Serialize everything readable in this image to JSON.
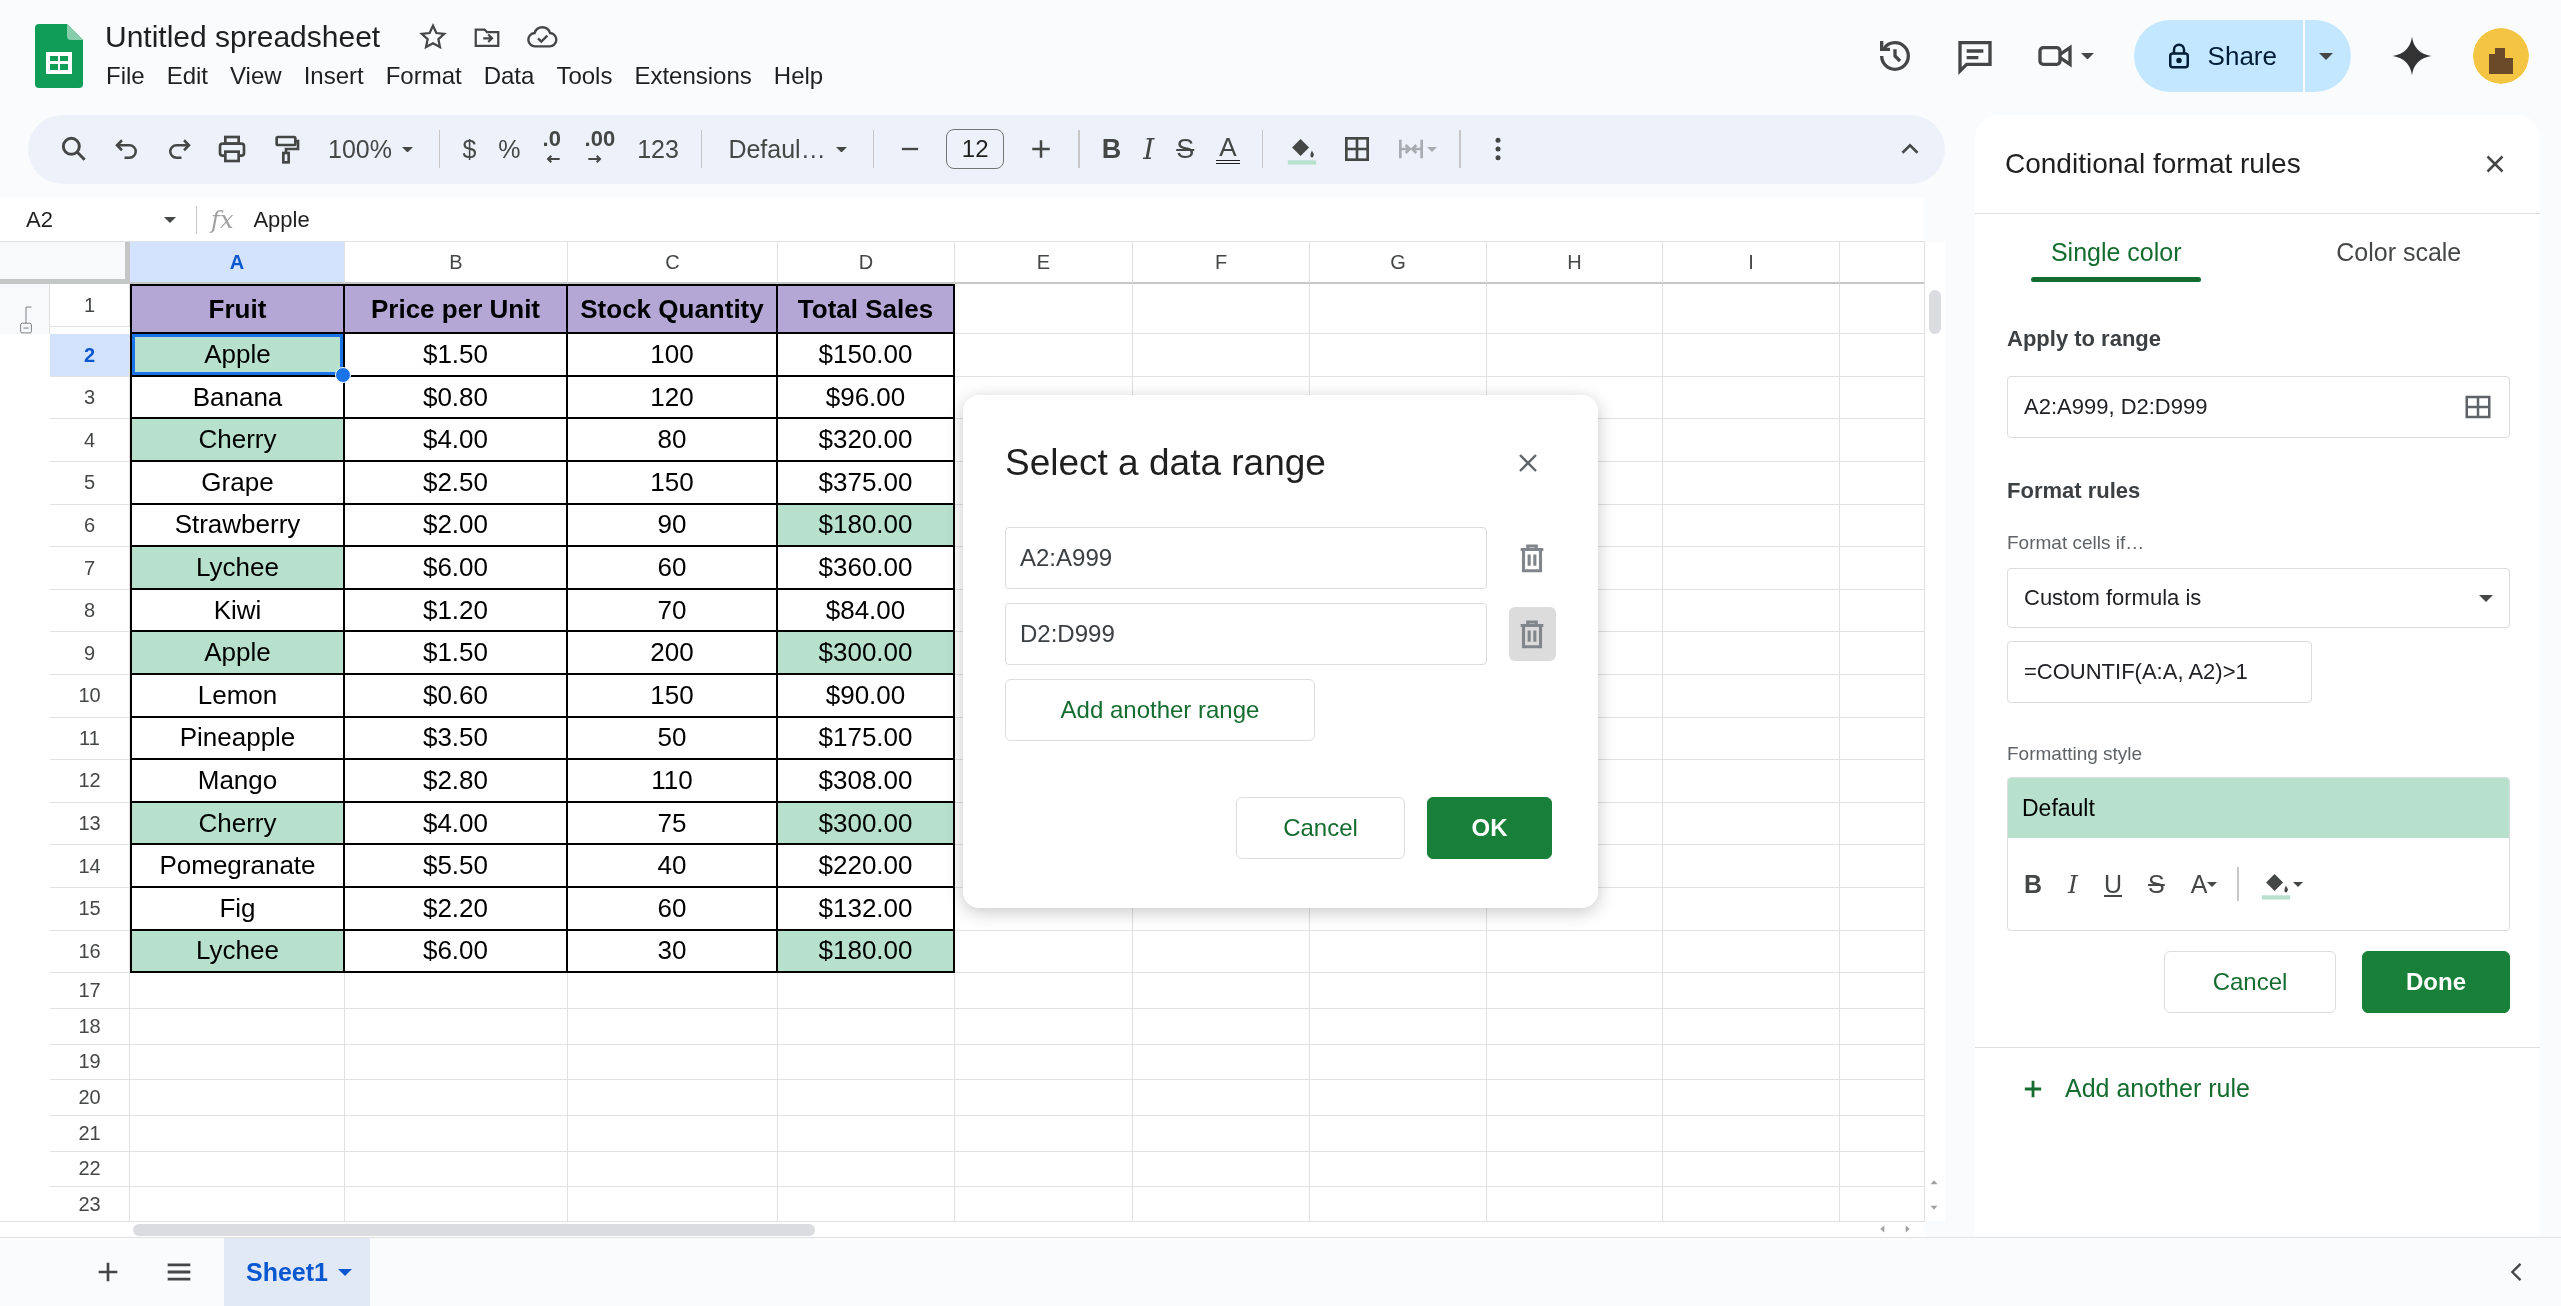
{
  "app": {
    "title": "Untitled spreadsheet",
    "menus": [
      "File",
      "Edit",
      "View",
      "Insert",
      "Format",
      "Data",
      "Tools",
      "Extensions",
      "Help"
    ],
    "share": "Share"
  },
  "toolbar": [
    {
      "kind": "search"
    },
    {
      "kind": "undo"
    },
    {
      "kind": "redo"
    },
    {
      "kind": "print"
    },
    {
      "kind": "paint"
    },
    {
      "kind": "dropdown",
      "text": "100%"
    },
    {
      "kind": "divider"
    },
    {
      "kind": "glyph",
      "text": "$"
    },
    {
      "kind": "glyph",
      "text": "%"
    },
    {
      "kind": "decrease",
      "text": ".0"
    },
    {
      "kind": "increase",
      "text": ".00"
    },
    {
      "kind": "glyph",
      "text": "123"
    },
    {
      "kind": "divider"
    },
    {
      "kind": "dropdown",
      "text": "Defaul…"
    },
    {
      "kind": "divider"
    },
    {
      "kind": "minus"
    },
    {
      "kind": "field",
      "text": "12"
    },
    {
      "kind": "plus"
    },
    {
      "kind": "divider"
    },
    {
      "kind": "bold",
      "text": "B"
    },
    {
      "kind": "italic",
      "text": "I"
    },
    {
      "kind": "strike",
      "text": "S"
    },
    {
      "kind": "color",
      "text": "A"
    },
    {
      "kind": "divider"
    },
    {
      "kind": "fill"
    },
    {
      "kind": "borders"
    },
    {
      "kind": "merge"
    },
    {
      "kind": "divider"
    },
    {
      "kind": "more"
    }
  ],
  "formula_bar": {
    "cell": "A2",
    "fx": "fx",
    "value": "Apple"
  },
  "sheet": {
    "columns": [
      {
        "label": "A",
        "selected": true
      },
      {
        "label": "B",
        "selected": false
      },
      {
        "label": "C",
        "selected": false
      },
      {
        "label": "D",
        "selected": false
      },
      {
        "label": "E",
        "selected": false
      },
      {
        "label": "F",
        "selected": false
      },
      {
        "label": "G",
        "selected": false
      },
      {
        "label": "H",
        "selected": false
      },
      {
        "label": "I",
        "selected": false
      }
    ],
    "rows": [
      {
        "number": "1",
        "selected": false,
        "kind": "header",
        "cells": [
          {
            "text": "Fruit",
            "highlight": false,
            "selected": false
          },
          {
            "text": "Price per Unit",
            "highlight": false,
            "selected": false
          },
          {
            "text": "Stock Quantity",
            "highlight": false,
            "selected": false
          },
          {
            "text": "Total Sales",
            "highlight": false,
            "selected": false
          }
        ]
      },
      {
        "number": "2",
        "selected": true,
        "kind": "data",
        "cells": [
          {
            "text": "Apple",
            "highlight": true,
            "selected": true
          },
          {
            "text": "$1.50",
            "highlight": false,
            "selected": false
          },
          {
            "text": "100",
            "highlight": false,
            "selected": false
          },
          {
            "text": "$150.00",
            "highlight": false,
            "selected": false
          }
        ]
      },
      {
        "number": "3",
        "selected": false,
        "kind": "data",
        "cells": [
          {
            "text": "Banana",
            "highlight": false,
            "selected": false
          },
          {
            "text": "$0.80",
            "highlight": false,
            "selected": false
          },
          {
            "text": "120",
            "highlight": false,
            "selected": false
          },
          {
            "text": "$96.00",
            "highlight": false,
            "selected": false
          }
        ]
      },
      {
        "number": "4",
        "selected": false,
        "kind": "data",
        "cells": [
          {
            "text": "Cherry",
            "highlight": true,
            "selected": false
          },
          {
            "text": "$4.00",
            "highlight": false,
            "selected": false
          },
          {
            "text": "80",
            "highlight": false,
            "selected": false
          },
          {
            "text": "$320.00",
            "highlight": false,
            "selected": false
          }
        ]
      },
      {
        "number": "5",
        "selected": false,
        "kind": "data",
        "cells": [
          {
            "text": "Grape",
            "highlight": false,
            "selected": false
          },
          {
            "text": "$2.50",
            "highlight": false,
            "selected": false
          },
          {
            "text": "150",
            "highlight": false,
            "selected": false
          },
          {
            "text": "$375.00",
            "highlight": false,
            "selected": false
          }
        ]
      },
      {
        "number": "6",
        "selected": false,
        "kind": "data",
        "cells": [
          {
            "text": "Strawberry",
            "highlight": false,
            "selected": false
          },
          {
            "text": "$2.00",
            "highlight": false,
            "selected": false
          },
          {
            "text": "90",
            "highlight": false,
            "selected": false
          },
          {
            "text": "$180.00",
            "highlight": true,
            "selected": false
          }
        ]
      },
      {
        "number": "7",
        "selected": false,
        "kind": "data",
        "cells": [
          {
            "text": "Lychee",
            "highlight": true,
            "selected": false
          },
          {
            "text": "$6.00",
            "highlight": false,
            "selected": false
          },
          {
            "text": "60",
            "highlight": false,
            "selected": false
          },
          {
            "text": "$360.00",
            "highlight": false,
            "selected": false
          }
        ]
      },
      {
        "number": "8",
        "selected": false,
        "kind": "data",
        "cells": [
          {
            "text": "Kiwi",
            "highlight": false,
            "selected": false
          },
          {
            "text": "$1.20",
            "highlight": false,
            "selected": false
          },
          {
            "text": "70",
            "highlight": false,
            "selected": false
          },
          {
            "text": "$84.00",
            "highlight": false,
            "selected": false
          }
        ]
      },
      {
        "number": "9",
        "selected": false,
        "kind": "data",
        "cells": [
          {
            "text": "Apple",
            "highlight": true,
            "selected": false
          },
          {
            "text": "$1.50",
            "highlight": false,
            "selected": false
          },
          {
            "text": "200",
            "highlight": false,
            "selected": false
          },
          {
            "text": "$300.00",
            "highlight": true,
            "selected": false
          }
        ]
      },
      {
        "number": "10",
        "selected": false,
        "kind": "data",
        "cells": [
          {
            "text": "Lemon",
            "highlight": false,
            "selected": false
          },
          {
            "text": "$0.60",
            "highlight": false,
            "selected": false
          },
          {
            "text": "150",
            "highlight": false,
            "selected": false
          },
          {
            "text": "$90.00",
            "highlight": false,
            "selected": false
          }
        ]
      },
      {
        "number": "11",
        "selected": false,
        "kind": "data",
        "cells": [
          {
            "text": "Pineapple",
            "highlight": false,
            "selected": false
          },
          {
            "text": "$3.50",
            "highlight": false,
            "selected": false
          },
          {
            "text": "50",
            "highlight": false,
            "selected": false
          },
          {
            "text": "$175.00",
            "highlight": false,
            "selected": false
          }
        ]
      },
      {
        "number": "12",
        "selected": false,
        "kind": "data",
        "cells": [
          {
            "text": "Mango",
            "highlight": false,
            "selected": false
          },
          {
            "text": "$2.80",
            "highlight": false,
            "selected": false
          },
          {
            "text": "110",
            "highlight": false,
            "selected": false
          },
          {
            "text": "$308.00",
            "highlight": false,
            "selected": false
          }
        ]
      },
      {
        "number": "13",
        "selected": false,
        "kind": "data",
        "cells": [
          {
            "text": "Cherry",
            "highlight": true,
            "selected": false
          },
          {
            "text": "$4.00",
            "highlight": false,
            "selected": false
          },
          {
            "text": "75",
            "highlight": false,
            "selected": false
          },
          {
            "text": "$300.00",
            "highlight": true,
            "selected": false
          }
        ]
      },
      {
        "number": "14",
        "selected": false,
        "kind": "data",
        "cells": [
          {
            "text": "Pomegranate",
            "highlight": false,
            "selected": false
          },
          {
            "text": "$5.50",
            "highlight": false,
            "selected": false
          },
          {
            "text": "40",
            "highlight": false,
            "selected": false
          },
          {
            "text": "$220.00",
            "highlight": false,
            "selected": false
          }
        ]
      },
      {
        "number": "15",
        "selected": false,
        "kind": "data",
        "cells": [
          {
            "text": "Fig",
            "highlight": false,
            "selected": false
          },
          {
            "text": "$2.20",
            "highlight": false,
            "selected": false
          },
          {
            "text": "60",
            "highlight": false,
            "selected": false
          },
          {
            "text": "$132.00",
            "highlight": false,
            "selected": false
          }
        ]
      },
      {
        "number": "16",
        "selected": false,
        "kind": "data",
        "cells": [
          {
            "text": "Lychee",
            "highlight": true,
            "selected": false
          },
          {
            "text": "$6.00",
            "highlight": false,
            "selected": false
          },
          {
            "text": "30",
            "highlight": false,
            "selected": false
          },
          {
            "text": "$180.00",
            "highlight": true,
            "selected": false
          }
        ]
      },
      {
        "number": "17",
        "selected": false,
        "kind": "empty"
      },
      {
        "number": "18",
        "selected": false,
        "kind": "empty"
      },
      {
        "number": "19",
        "selected": false,
        "kind": "empty"
      },
      {
        "number": "20",
        "selected": false,
        "kind": "empty"
      },
      {
        "number": "21",
        "selected": false,
        "kind": "empty"
      },
      {
        "number": "22",
        "selected": false,
        "kind": "empty"
      },
      {
        "number": "23",
        "selected": false,
        "kind": "empty"
      }
    ],
    "tabs": [
      {
        "label": "Sheet1",
        "selected": true
      }
    ]
  },
  "dialog": {
    "title": "Select a data range",
    "ranges": [
      {
        "value": "A2:A999",
        "hovered": false
      },
      {
        "value": "D2:D999",
        "hovered": true
      }
    ],
    "add": "Add another range",
    "cancel": "Cancel",
    "ok": "OK"
  },
  "panel": {
    "title": "Conditional format rules",
    "tabs": [
      {
        "label": "Single color",
        "selected": true
      },
      {
        "label": "Color scale",
        "selected": false
      }
    ],
    "apply_label": "Apply to range",
    "range": "A2:A999, D2:D999",
    "rules_label": "Format rules",
    "condition_label": "Format cells if…",
    "condition": "Custom formula is",
    "formula": "=COUNTIF(A:A, A2)>1",
    "style_label": "Formatting style",
    "style_preview": "Default",
    "style_tools": [
      {
        "kind": "bold",
        "text": "B"
      },
      {
        "kind": "italic",
        "text": "I"
      },
      {
        "kind": "underline",
        "text": "U"
      },
      {
        "kind": "strike",
        "text": "S"
      },
      {
        "kind": "color",
        "text": "A"
      },
      {
        "kind": "divider"
      },
      {
        "kind": "fill"
      }
    ],
    "cancel": "Cancel",
    "done": "Done",
    "add_rule": "Add another rule"
  }
}
